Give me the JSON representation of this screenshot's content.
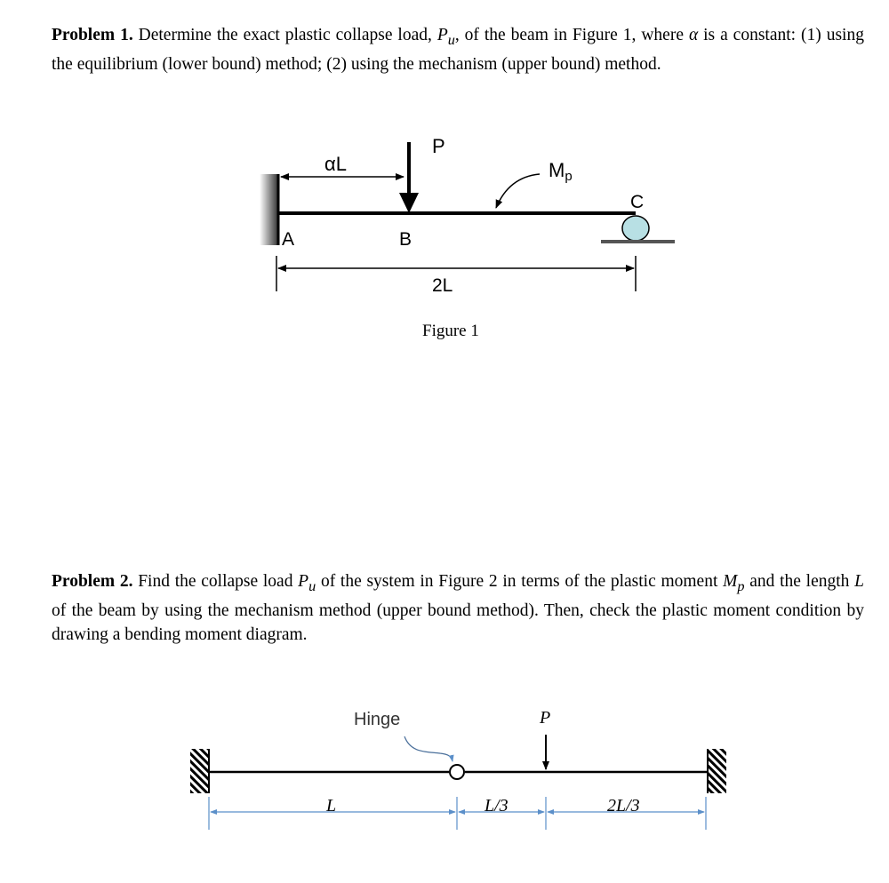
{
  "problem1": {
    "heading": "Problem 1.",
    "text_a": " Determine the exact plastic collapse load, ",
    "var_P": "P",
    "sub_u": "u",
    "text_b": ", of the beam in Figure 1, where ",
    "alpha": "α",
    "text_c": " is a constant: (1) using the equilibrium (lower bound) method; (2) using the mechanism (upper bound) method."
  },
  "figure1": {
    "caption": "Figure 1",
    "load_label": "P",
    "alpha_L": "αL",
    "moment_label": "M",
    "moment_sub": "p",
    "point_a": "A",
    "point_b": "B",
    "point_c": "C",
    "span_label": "2L",
    "roller_color": "#b8e0e4"
  },
  "problem2": {
    "heading": "Problem 2.",
    "text_a": " Find the collapse load ",
    "var_P": "P",
    "sub_u": "u",
    "text_b": " of the system in Figure 2 in terms of the plastic moment ",
    "var_M": "M",
    "sub_p": "p",
    "text_c": " and the length ",
    "var_L": "L",
    "text_d": " of the beam by using the mechanism method (upper bound method). Then, check the plastic moment condition by drawing a bending moment diagram."
  },
  "figure2": {
    "hinge_label": "Hinge",
    "load_label": "P",
    "dim1": "L",
    "dim2": "L/3",
    "dim3": "2L/3",
    "dimension_color": "#5b8fc9",
    "hinge_label_color": "#333333"
  }
}
